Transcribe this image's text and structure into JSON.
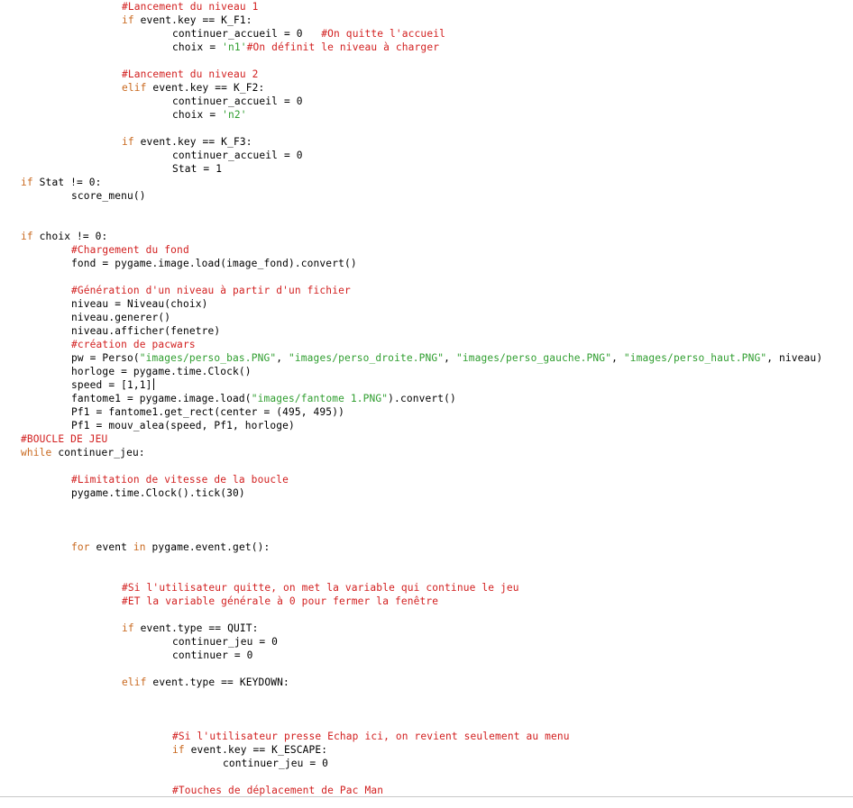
{
  "editor": {
    "caret_line": 28,
    "colors": {
      "keyword": "#c9691f",
      "comment": "#d21f1f",
      "string": "#2f9e2f",
      "text": "#000000",
      "background": "#ffffff"
    },
    "lines": [
      {
        "indent": 2,
        "parts": [
          {
            "t": "c",
            "v": "#Lancement du niveau 1"
          }
        ]
      },
      {
        "indent": 2,
        "parts": [
          {
            "t": "k",
            "v": "if"
          },
          {
            "t": "n",
            "v": " event.key == K_F1:"
          }
        ]
      },
      {
        "indent": 3,
        "parts": [
          {
            "t": "n",
            "v": "continuer_accueil = 0   "
          },
          {
            "t": "c",
            "v": "#On quitte l'accueil"
          }
        ]
      },
      {
        "indent": 3,
        "parts": [
          {
            "t": "n",
            "v": "choix = "
          },
          {
            "t": "s",
            "v": "'n1'"
          },
          {
            "t": "c",
            "v": "#On définit le niveau à charger"
          }
        ]
      },
      {
        "indent": 0,
        "parts": []
      },
      {
        "indent": 2,
        "parts": [
          {
            "t": "c",
            "v": "#Lancement du niveau 2"
          }
        ]
      },
      {
        "indent": 2,
        "parts": [
          {
            "t": "k",
            "v": "elif"
          },
          {
            "t": "n",
            "v": " event.key == K_F2:"
          }
        ]
      },
      {
        "indent": 3,
        "parts": [
          {
            "t": "n",
            "v": "continuer_accueil = 0"
          }
        ]
      },
      {
        "indent": 3,
        "parts": [
          {
            "t": "n",
            "v": "choix = "
          },
          {
            "t": "s",
            "v": "'n2'"
          }
        ]
      },
      {
        "indent": 0,
        "parts": []
      },
      {
        "indent": 2,
        "parts": [
          {
            "t": "k",
            "v": "if"
          },
          {
            "t": "n",
            "v": " event.key == K_F3:"
          }
        ]
      },
      {
        "indent": 3,
        "parts": [
          {
            "t": "n",
            "v": "continuer_accueil = 0"
          }
        ]
      },
      {
        "indent": 3,
        "parts": [
          {
            "t": "n",
            "v": "Stat = 1"
          }
        ]
      },
      {
        "indent": 0,
        "parts": [
          {
            "t": "k",
            "v": "if"
          },
          {
            "t": "n",
            "v": " Stat != 0:"
          }
        ]
      },
      {
        "indent": 1,
        "parts": [
          {
            "t": "n",
            "v": "score_menu()"
          }
        ]
      },
      {
        "indent": 0,
        "parts": []
      },
      {
        "indent": 0,
        "parts": []
      },
      {
        "indent": 0,
        "parts": [
          {
            "t": "k",
            "v": "if"
          },
          {
            "t": "n",
            "v": " choix != 0:"
          }
        ]
      },
      {
        "indent": 1,
        "parts": [
          {
            "t": "c",
            "v": "#Chargement du fond"
          }
        ]
      },
      {
        "indent": 1,
        "parts": [
          {
            "t": "n",
            "v": "fond = pygame.image.load(image_fond).convert()"
          }
        ]
      },
      {
        "indent": 0,
        "parts": []
      },
      {
        "indent": 1,
        "parts": [
          {
            "t": "c",
            "v": "#Génération d'un niveau à partir d'un fichier"
          }
        ]
      },
      {
        "indent": 1,
        "parts": [
          {
            "t": "n",
            "v": "niveau = Niveau(choix)"
          }
        ]
      },
      {
        "indent": 1,
        "parts": [
          {
            "t": "n",
            "v": "niveau.generer()"
          }
        ]
      },
      {
        "indent": 1,
        "parts": [
          {
            "t": "n",
            "v": "niveau.afficher(fenetre)"
          }
        ]
      },
      {
        "indent": 1,
        "parts": [
          {
            "t": "c",
            "v": "#création de pacwars"
          }
        ]
      },
      {
        "indent": 1,
        "parts": [
          {
            "t": "n",
            "v": "pw = Perso("
          },
          {
            "t": "s",
            "v": "\"images/perso_bas.PNG\""
          },
          {
            "t": "n",
            "v": ", "
          },
          {
            "t": "s",
            "v": "\"images/perso_droite.PNG\""
          },
          {
            "t": "n",
            "v": ", "
          },
          {
            "t": "s",
            "v": "\"images/perso_gauche.PNG\""
          },
          {
            "t": "n",
            "v": ", "
          },
          {
            "t": "s",
            "v": "\"images/perso_haut.PNG\""
          },
          {
            "t": "n",
            "v": ", niveau)"
          }
        ]
      },
      {
        "indent": 1,
        "parts": [
          {
            "t": "n",
            "v": "horloge = pygame.time.Clock()"
          }
        ]
      },
      {
        "indent": 1,
        "parts": [
          {
            "t": "n",
            "v": "speed = [1,1]"
          }
        ]
      },
      {
        "indent": 1,
        "parts": [
          {
            "t": "n",
            "v": "fantome1 = pygame.image.load("
          },
          {
            "t": "s",
            "v": "\"images/fantome 1.PNG\""
          },
          {
            "t": "n",
            "v": ").convert()"
          }
        ]
      },
      {
        "indent": 1,
        "parts": [
          {
            "t": "n",
            "v": "Pf1 = fantome1.get_rect(center = (495, 495))"
          }
        ]
      },
      {
        "indent": 1,
        "parts": [
          {
            "t": "n",
            "v": "Pf1 = mouv_alea(speed, Pf1, horloge)"
          }
        ]
      },
      {
        "indent": 0,
        "parts": [
          {
            "t": "c",
            "v": "#BOUCLE DE JEU"
          }
        ]
      },
      {
        "indent": 0,
        "parts": [
          {
            "t": "k",
            "v": "while"
          },
          {
            "t": "n",
            "v": " continuer_jeu:"
          }
        ]
      },
      {
        "indent": 0,
        "parts": []
      },
      {
        "indent": 1,
        "parts": [
          {
            "t": "c",
            "v": "#Limitation de vitesse de la boucle"
          }
        ]
      },
      {
        "indent": 1,
        "parts": [
          {
            "t": "n",
            "v": "pygame.time.Clock().tick(30)"
          }
        ]
      },
      {
        "indent": 0,
        "parts": []
      },
      {
        "indent": 0,
        "parts": []
      },
      {
        "indent": 0,
        "parts": []
      },
      {
        "indent": 1,
        "parts": [
          {
            "t": "k",
            "v": "for"
          },
          {
            "t": "n",
            "v": " event "
          },
          {
            "t": "k",
            "v": "in"
          },
          {
            "t": "n",
            "v": " pygame.event.get():"
          }
        ]
      },
      {
        "indent": 0,
        "parts": []
      },
      {
        "indent": 0,
        "parts": []
      },
      {
        "indent": 2,
        "parts": [
          {
            "t": "c",
            "v": "#Si l'utilisateur quitte, on met la variable qui continue le jeu"
          }
        ]
      },
      {
        "indent": 2,
        "parts": [
          {
            "t": "c",
            "v": "#ET la variable générale à 0 pour fermer la fenêtre"
          }
        ]
      },
      {
        "indent": 0,
        "parts": []
      },
      {
        "indent": 2,
        "parts": [
          {
            "t": "k",
            "v": "if"
          },
          {
            "t": "n",
            "v": " event.type == QUIT:"
          }
        ]
      },
      {
        "indent": 3,
        "parts": [
          {
            "t": "n",
            "v": "continuer_jeu = 0"
          }
        ]
      },
      {
        "indent": 3,
        "parts": [
          {
            "t": "n",
            "v": "continuer = 0"
          }
        ]
      },
      {
        "indent": 0,
        "parts": []
      },
      {
        "indent": 2,
        "parts": [
          {
            "t": "k",
            "v": "elif"
          },
          {
            "t": "n",
            "v": " event.type == KEYDOWN:"
          }
        ]
      },
      {
        "indent": 0,
        "parts": []
      },
      {
        "indent": 0,
        "parts": []
      },
      {
        "indent": 0,
        "parts": []
      },
      {
        "indent": 3,
        "parts": [
          {
            "t": "c",
            "v": "#Si l'utilisateur presse Echap ici, on revient seulement au menu"
          }
        ]
      },
      {
        "indent": 3,
        "parts": [
          {
            "t": "k",
            "v": "if"
          },
          {
            "t": "n",
            "v": " event.key == K_ESCAPE:"
          }
        ]
      },
      {
        "indent": 4,
        "parts": [
          {
            "t": "n",
            "v": "continuer_jeu = 0"
          }
        ]
      },
      {
        "indent": 0,
        "parts": []
      },
      {
        "indent": 3,
        "parts": [
          {
            "t": "c",
            "v": "#Touches de déplacement de Pac Man"
          }
        ]
      }
    ]
  }
}
